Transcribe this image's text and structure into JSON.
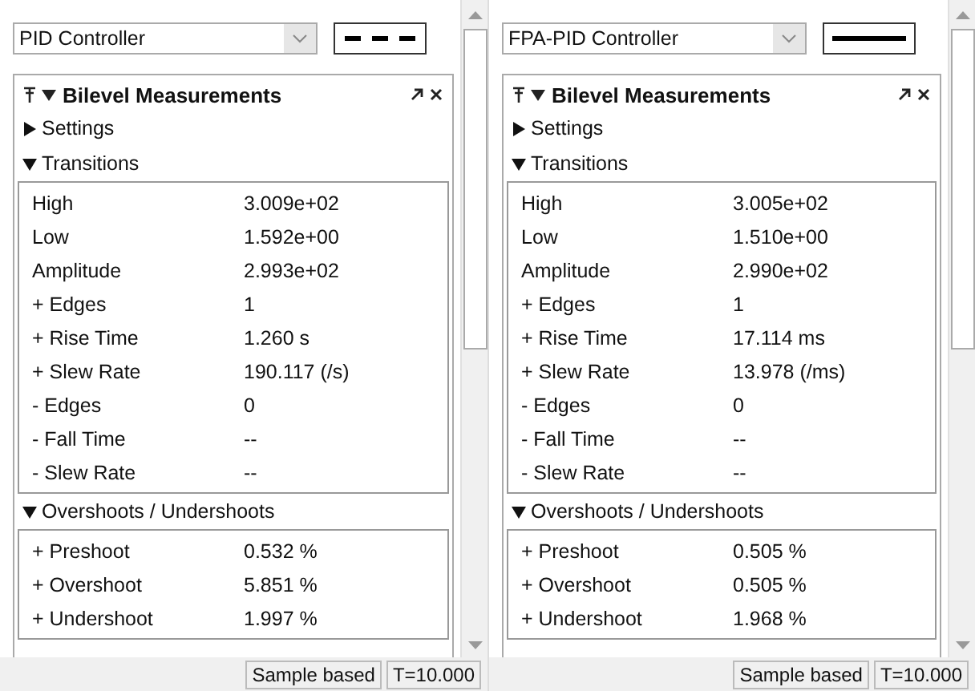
{
  "panels": [
    {
      "controller": "PID Controller",
      "line_style": {
        "kind": "dashed"
      },
      "title": "Bilevel Measurements",
      "sections": [
        {
          "label": "Settings",
          "expanded": false
        },
        {
          "label": "Transitions",
          "expanded": true,
          "rows": [
            {
              "name": "High",
              "value": "3.009e+02"
            },
            {
              "name": "Low",
              "value": "1.592e+00"
            },
            {
              "name": "Amplitude",
              "value": "2.993e+02"
            },
            {
              "name": "+ Edges",
              "value": "1"
            },
            {
              "name": "+ Rise Time",
              "value": "1.260 s"
            },
            {
              "name": "+ Slew Rate",
              "value": "190.117 (/s)"
            },
            {
              "name": "- Edges",
              "value": "0"
            },
            {
              "name": "- Fall Time",
              "value": "--"
            },
            {
              "name": "- Slew Rate",
              "value": "--"
            }
          ]
        },
        {
          "label": "Overshoots / Undershoots",
          "expanded": true,
          "rows": [
            {
              "name": "+ Preshoot",
              "value": "0.532 %"
            },
            {
              "name": "+ Overshoot",
              "value": "5.851 %"
            },
            {
              "name": "+ Undershoot",
              "value": "1.997 %"
            }
          ]
        }
      ],
      "status": {
        "mode": "Sample based",
        "time": "T=10.000"
      }
    },
    {
      "controller": "FPA-PID Controller",
      "line_style": {
        "kind": "solid"
      },
      "title": "Bilevel Measurements",
      "sections": [
        {
          "label": "Settings",
          "expanded": false
        },
        {
          "label": "Transitions",
          "expanded": true,
          "rows": [
            {
              "name": "High",
              "value": "3.005e+02"
            },
            {
              "name": "Low",
              "value": "1.510e+00"
            },
            {
              "name": "Amplitude",
              "value": "2.990e+02"
            },
            {
              "name": "+ Edges",
              "value": "1"
            },
            {
              "name": "+ Rise Time",
              "value": "17.114 ms"
            },
            {
              "name": "+ Slew Rate",
              "value": "13.978 (/ms)"
            },
            {
              "name": "- Edges",
              "value": "0"
            },
            {
              "name": "- Fall Time",
              "value": "--"
            },
            {
              "name": "- Slew Rate",
              "value": "--"
            }
          ]
        },
        {
          "label": "Overshoots / Undershoots",
          "expanded": true,
          "rows": [
            {
              "name": "+ Preshoot",
              "value": "0.505 %"
            },
            {
              "name": "+ Overshoot",
              "value": "0.505 %"
            },
            {
              "name": "+ Undershoot",
              "value": "1.968 %"
            }
          ]
        }
      ],
      "status": {
        "mode": "Sample based",
        "time": "T=10.000"
      }
    }
  ]
}
